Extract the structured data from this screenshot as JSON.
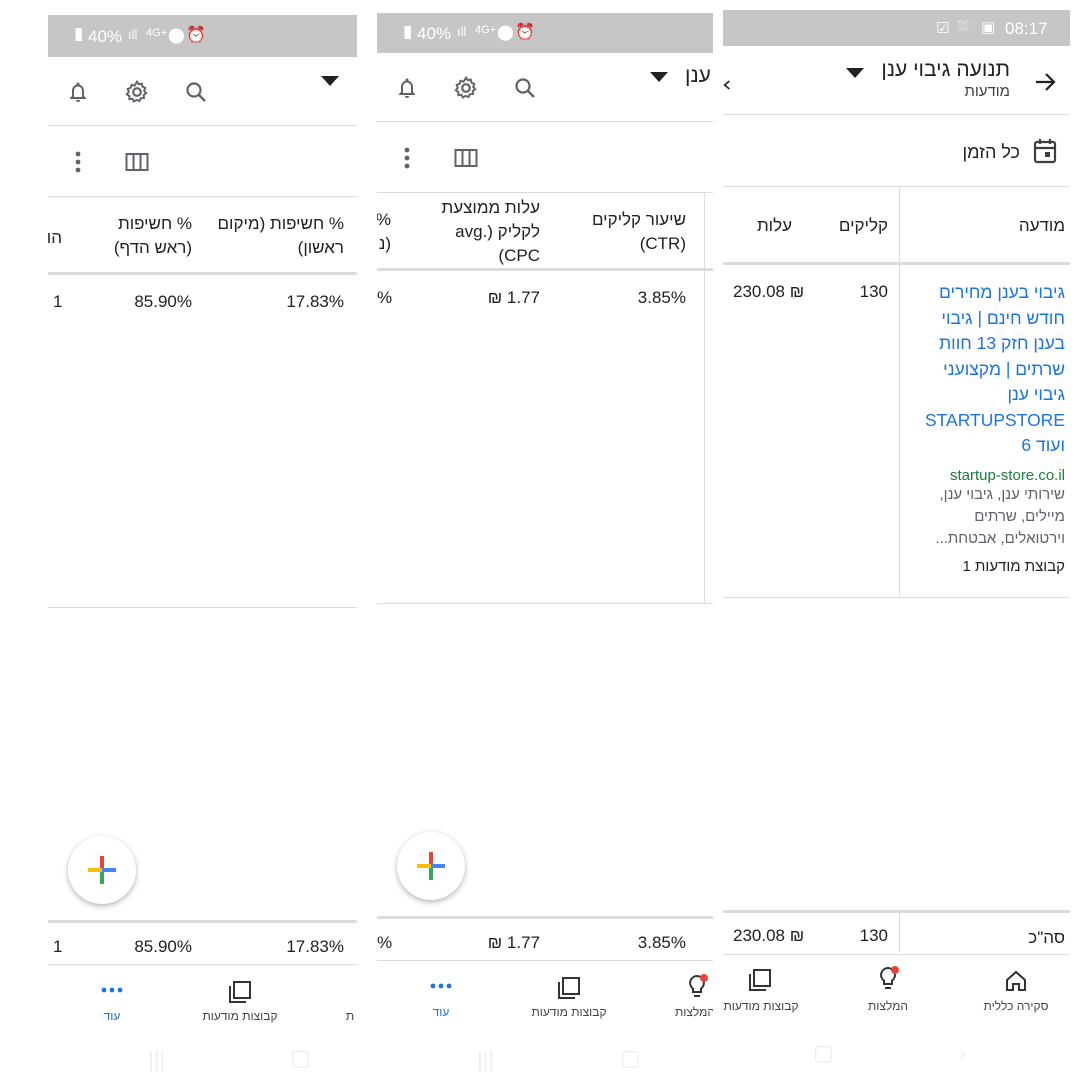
{
  "panels": {
    "left": {
      "status_text": "40%",
      "columns": [
        {
          "header": "% חשיפות (מיקום ראשון)",
          "value": "17.83%",
          "total": "17.83%"
        },
        {
          "header": "% חשיפות (ראש הדף)",
          "value": "85.90%",
          "total": "85.90%"
        },
        {
          "header": "הו",
          "value": "1",
          "total": "1"
        }
      ],
      "nav": [
        {
          "label": "ת",
          "icon": "lightbulb-icon"
        },
        {
          "label": "קבוצות מודעות",
          "icon": "ad-groups-icon"
        },
        {
          "label": "עוד",
          "icon": "more-dots-icon",
          "active": true
        }
      ]
    },
    "middle": {
      "status_text": "40%",
      "title_fragment": "ענן",
      "columns": [
        {
          "header": "שיעור קליקים (CTR)",
          "value": "3.85%",
          "total": "3.85%"
        },
        {
          "header": "עלות ממוצעת לקליק (.avg CPC)",
          "value": "₪ 1.77",
          "total": "₪ 1.77"
        },
        {
          "header": "%",
          "header_extra": "(נ",
          "value": "%",
          "total": "%"
        }
      ],
      "nav": [
        {
          "label": "המלצות",
          "icon": "lightbulb-icon"
        },
        {
          "label": "קבוצות מודעות",
          "icon": "ad-groups-icon"
        },
        {
          "label": "עוד",
          "icon": "more-dots-icon",
          "active": true
        }
      ]
    },
    "right": {
      "status_time": "08:17",
      "title": "תנועה גיבוי ענן",
      "subtitle": "מודעות",
      "date_range": "כל הזמן",
      "columns": {
        "ad": "מודעה",
        "clicks": "קליקים",
        "cost": "עלות"
      },
      "row": {
        "ad_title": "גיבוי בענן מחירים חודש חינם | גיבוי בענן חזק 13 חוות שרתים | מקצועני גיבוי ענן STARTUPSTORE ועוד 6",
        "ad_url": "startup-store.co.il",
        "ad_desc": "שירותי ענן, גיבוי ענן, מיילים, שרתים וירטואלים, אבטחת...",
        "ad_group": "קבוצת מודעות 1",
        "clicks": "130",
        "cost": "230.08 ₪"
      },
      "total": {
        "label": "סה\"כ",
        "clicks": "130",
        "cost": "230.08 ₪"
      },
      "nav": [
        {
          "label": "סקירה כללית",
          "icon": "home-icon"
        },
        {
          "label": "המלצות",
          "icon": "lightbulb-icon"
        },
        {
          "label": "קבוצות מודעות",
          "icon": "ad-groups-icon"
        }
      ]
    }
  },
  "colors": {
    "accent": "#1a73e8",
    "badge": "#ea4335",
    "url_green": "#188038",
    "status_bar": "#c6c6c6"
  }
}
